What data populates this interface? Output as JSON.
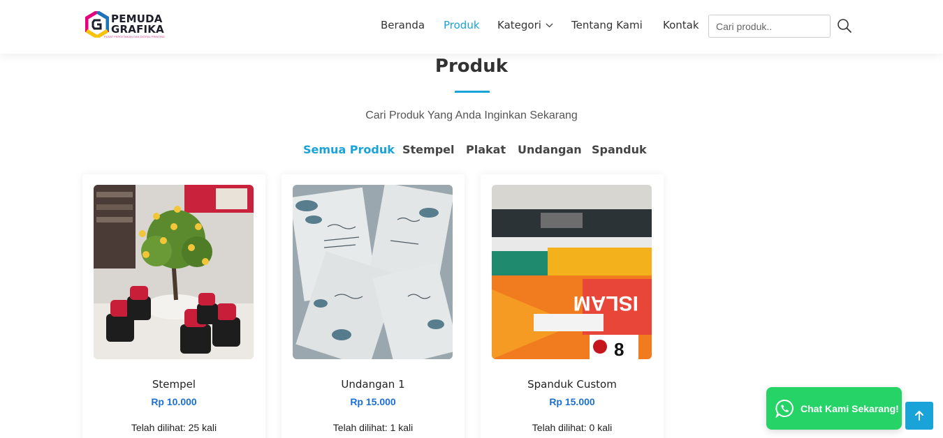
{
  "brand": {
    "name_line1": "PEMUDA",
    "name_line2": "GRAFIKA",
    "tagline": "PUSAT PERCETAKAN DAN DIGITAL PRINTING",
    "colors": {
      "magenta": "#e6007e",
      "blue": "#1b75bc",
      "yellow": "#f7c600",
      "cyan": "#29abe2"
    }
  },
  "nav": {
    "items": [
      {
        "label": "Beranda",
        "active": false
      },
      {
        "label": "Produk",
        "active": true
      },
      {
        "label": "Kategori",
        "active": false,
        "has_dropdown": true
      },
      {
        "label": "Tentang Kami",
        "active": false
      },
      {
        "label": "Kontak",
        "active": false
      }
    ]
  },
  "search": {
    "placeholder": "Cari produk..",
    "value": "",
    "icon": "search-icon"
  },
  "section": {
    "title": "Produk",
    "subtitle": "Cari Produk Yang Anda Inginkan Sekarang"
  },
  "filters": [
    {
      "label": "Semua Produk",
      "active": true
    },
    {
      "label": "Stempel",
      "active": false
    },
    {
      "label": "Plakat",
      "active": false
    },
    {
      "label": "Undangan",
      "active": false
    },
    {
      "label": "Spanduk",
      "active": false
    }
  ],
  "products": [
    {
      "name": "Stempel",
      "price": "Rp 10.000",
      "views": "Telah dilihat: 25 kali",
      "image": "stamp-photo"
    },
    {
      "name": "Undangan 1",
      "price": "Rp 15.000",
      "views": "Telah dilihat: 1 kali",
      "image": "invitation-photo"
    },
    {
      "name": "Spanduk Custom",
      "price": "Rp 15.000",
      "views": "Telah dilihat: 0 kali",
      "image": "banner-print-photo"
    }
  ],
  "whatsapp": {
    "label": "Chat Kami Sekarang!",
    "icon": "whatsapp-icon",
    "color": "#25d366"
  },
  "back_to_top": {
    "icon": "arrow-up-icon",
    "color": "#1aa3d9"
  },
  "accent_color": "#1aa3d9",
  "price_color": "#1b6fd6"
}
